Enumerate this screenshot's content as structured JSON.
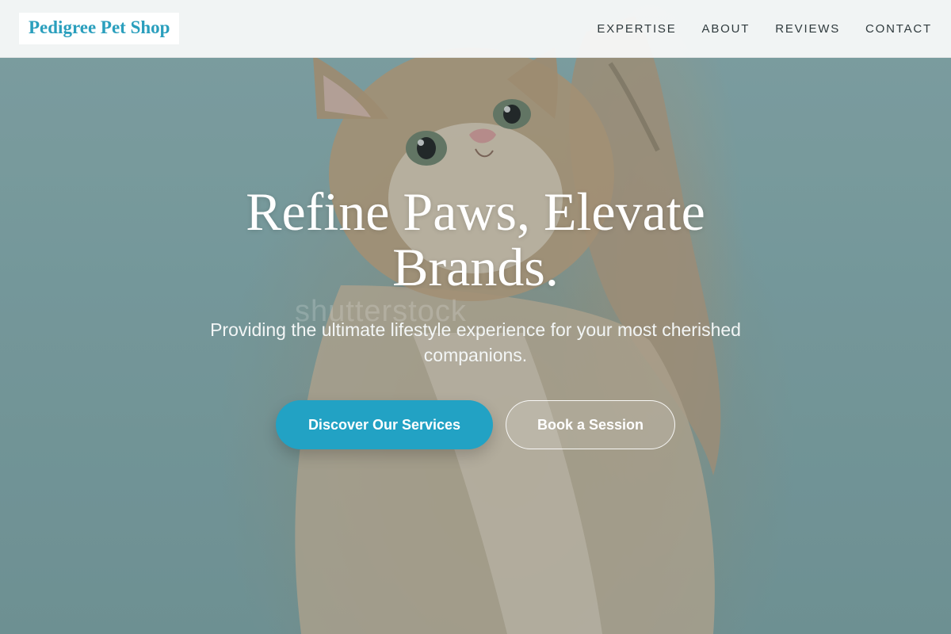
{
  "header": {
    "brand": "Pedigree Pet Shop",
    "nav": [
      {
        "label": "EXPERTISE"
      },
      {
        "label": "ABOUT"
      },
      {
        "label": "REVIEWS"
      },
      {
        "label": "CONTACT"
      }
    ]
  },
  "hero": {
    "title": "Refine Paws, Elevate Brands.",
    "subtitle": "Providing the ultimate lifestyle experience for your most cherished companions.",
    "primary_cta": "Discover Our Services",
    "secondary_cta": "Book a Session",
    "background_image": "kitten-reaching-up",
    "watermark": "shutterstock"
  },
  "colors": {
    "brand": "#2a9fbd",
    "primary_button": "#22a2c4",
    "header_bg": "#f8f9f9",
    "hero_bg": "#86a9ab"
  }
}
